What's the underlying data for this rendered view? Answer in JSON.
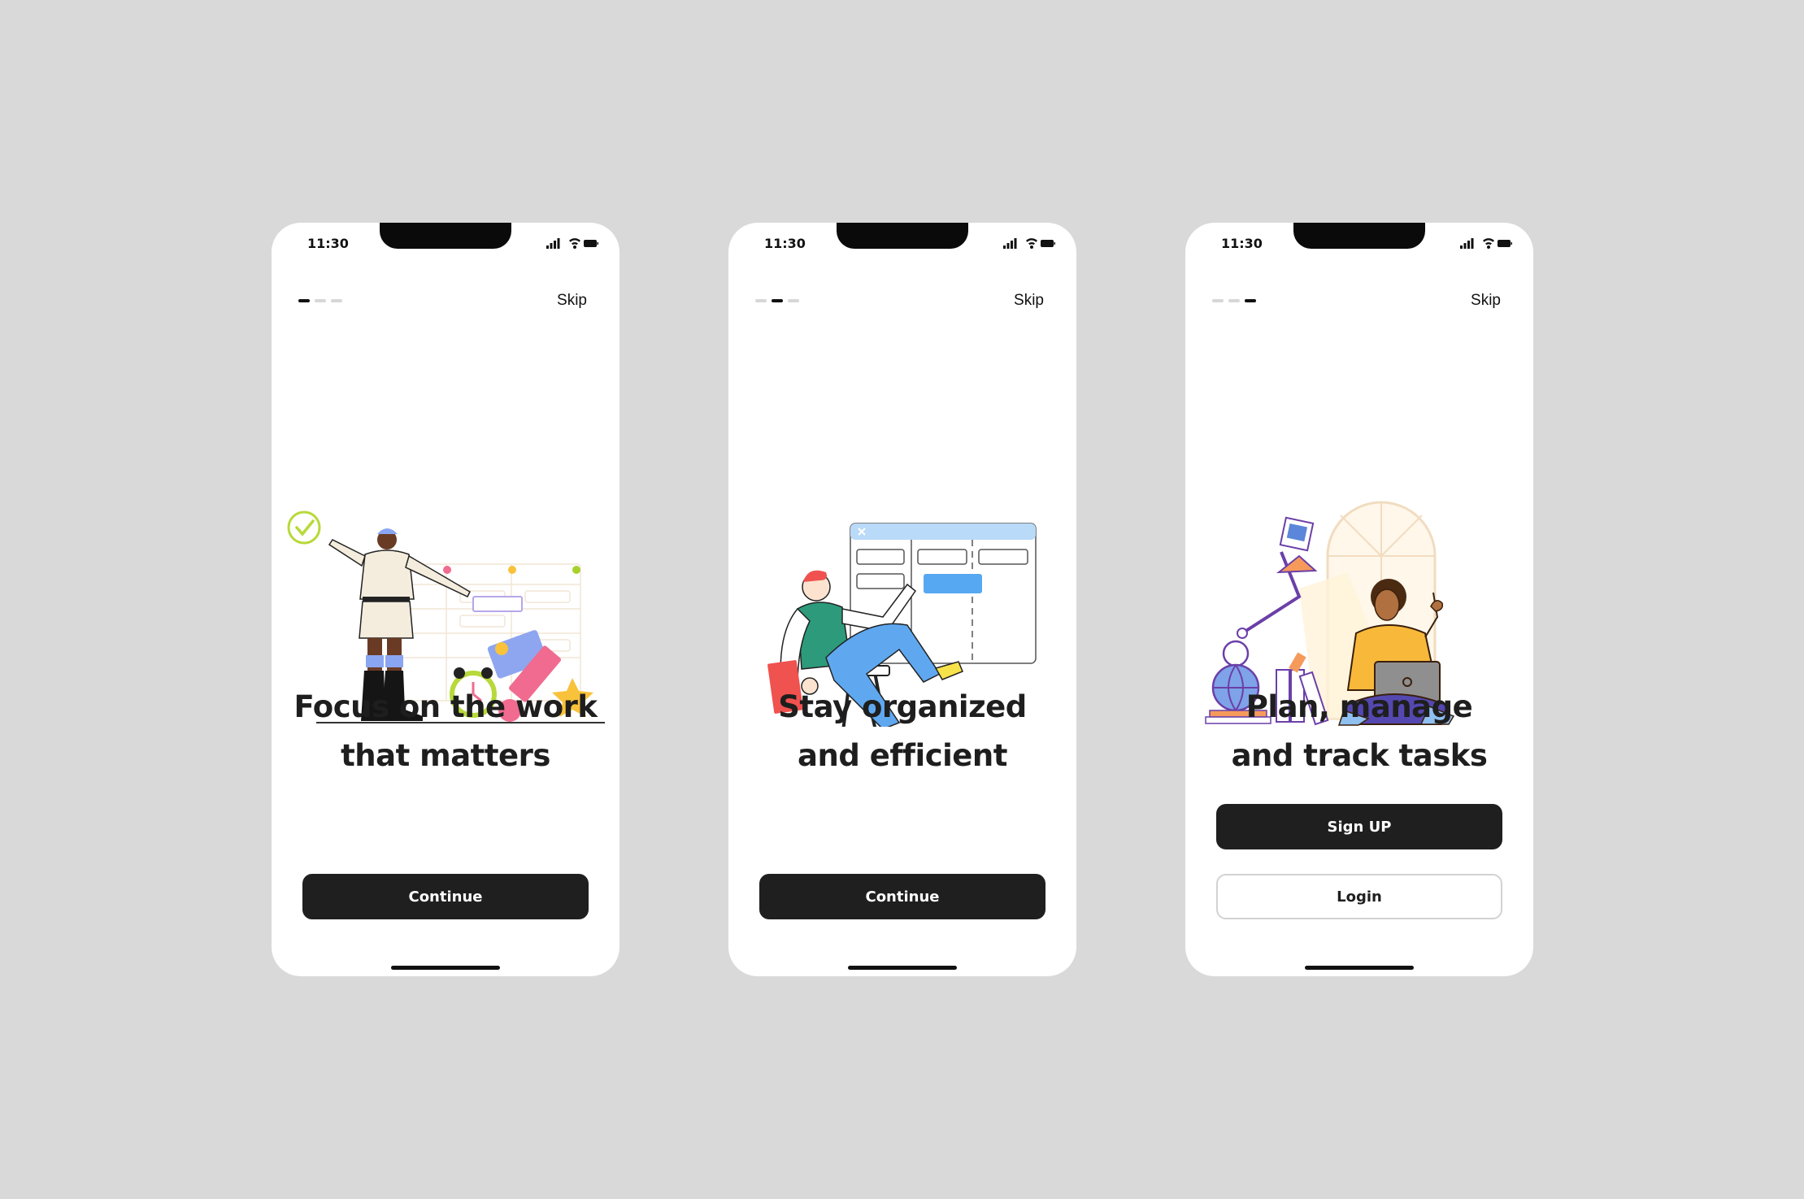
{
  "screens": [
    {
      "time": "11:30",
      "skip": "Skip",
      "title_line1": "Focus on the work",
      "title_line2": "that matters",
      "primary_button": "Continue",
      "page_indicator": {
        "active": 1,
        "total": 3
      },
      "illustration": "person-with-checkmark-and-schedule-illustration"
    },
    {
      "time": "11:30",
      "skip": "Skip",
      "title_line1": "Stay organized",
      "title_line2": "and efficient",
      "primary_button": "Continue",
      "page_indicator": {
        "active": 2,
        "total": 3
      },
      "illustration": "person-on-chair-with-board-illustration"
    },
    {
      "time": "11:30",
      "skip": "Skip",
      "title_line1": "Plan, manage",
      "title_line2": "and track tasks",
      "primary_button": "Sign UP",
      "secondary_button": "Login",
      "page_indicator": {
        "active": 3,
        "total": 3
      },
      "illustration": "person-with-laptop-and-lamp-illustration"
    }
  ],
  "colors": {
    "background": "#d9d9d9",
    "phone": "#ffffff",
    "button_dark": "#1f1f1f",
    "text": "#1e1e1e"
  }
}
